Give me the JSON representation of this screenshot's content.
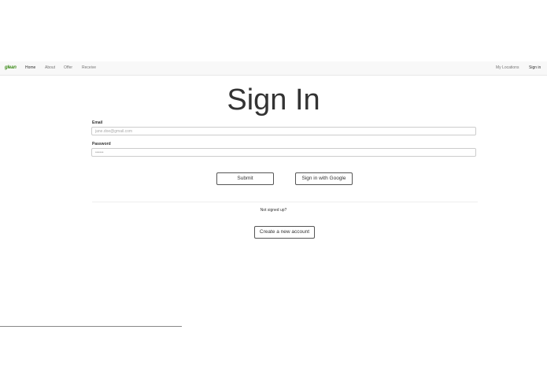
{
  "nav": {
    "brand": "glean",
    "items": [
      {
        "label": "Home"
      },
      {
        "label": "About"
      },
      {
        "label": "Offer"
      },
      {
        "label": "Receive"
      }
    ],
    "right": [
      {
        "label": "My Locations"
      },
      {
        "label": "Sign in"
      }
    ]
  },
  "page": {
    "title": "Sign In"
  },
  "form": {
    "email_label": "Email",
    "email_placeholder": "jane.doe@gmail.com",
    "password_label": "Password",
    "password_placeholder": "••••••",
    "submit_label": "Submit",
    "google_label": "Sign in with Google"
  },
  "signup": {
    "prompt": "Not signed up?",
    "button_label": "Create a new account"
  },
  "colors": {
    "brand": "#3f8d1c",
    "navbar_bg": "#f8f8f8"
  }
}
